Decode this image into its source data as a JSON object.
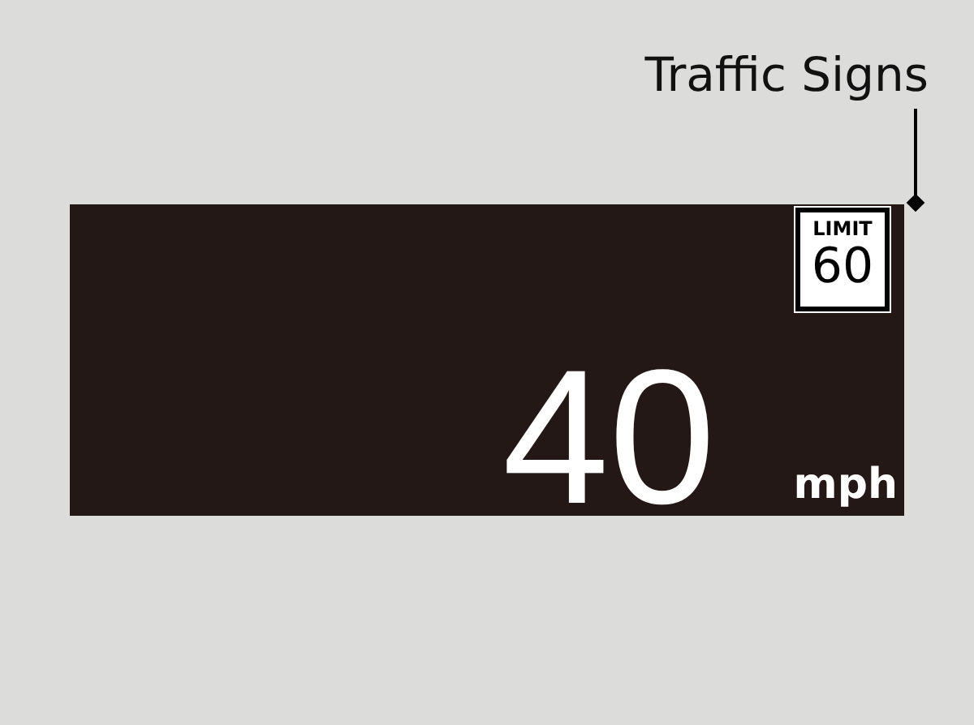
{
  "callout": {
    "label": "Traffic Signs"
  },
  "display": {
    "speed": "40",
    "unit": "mph",
    "sign": {
      "kind": "speed_limit",
      "title": "LIMIT",
      "value": "60"
    }
  }
}
